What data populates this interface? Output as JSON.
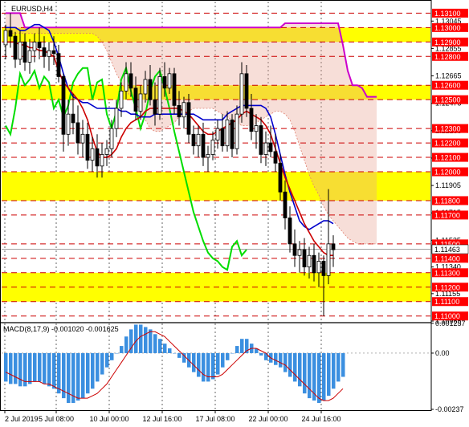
{
  "chart_data": {
    "type": "candlestick",
    "symbol": "EURUSD,H4",
    "indicator_label": "MACD(8,17,9) -0.001020 -0.001625",
    "price_axis": {
      "ylim": [
        1.10965,
        1.1318
      ],
      "ticks": [
        "1.13045",
        "1.12855",
        "1.12665",
        "1.12475",
        "1.12285",
        "1.12095",
        "1.11905",
        "1.11715",
        "1.11525",
        "1.11340",
        "1.11155",
        "1.10965"
      ]
    },
    "macd_axis": {
      "ylim": [
        -0.00237,
        0.00125
      ],
      "ticks": [
        "0.001257",
        "0.00",
        "-0.00237"
      ]
    },
    "x_ticks": [
      "2 Jul 2019",
      "5 Jul 08:00",
      "10 Jul 00:00",
      "12 Jul 16:00",
      "17 Jul 08:00",
      "22 Jul 00:00",
      "24 Jul 16:00"
    ],
    "levels": [
      {
        "label": "1.13100",
        "value": 1.131
      },
      {
        "label": "1.13000",
        "value": 1.13
      },
      {
        "label": "1.12900",
        "value": 1.129
      },
      {
        "label": "1.12800",
        "value": 1.128
      },
      {
        "label": "1.12600",
        "value": 1.126
      },
      {
        "label": "1.12500",
        "value": 1.125
      },
      {
        "label": "1.12300",
        "value": 1.123
      },
      {
        "label": "1.12200",
        "value": 1.122
      },
      {
        "label": "1.12100",
        "value": 1.121
      },
      {
        "label": "1.12000",
        "value": 1.12
      },
      {
        "label": "1.11800",
        "value": 1.118
      },
      {
        "label": "1.11700",
        "value": 1.117
      },
      {
        "label": "1.11500",
        "value": 1.115
      },
      {
        "label": "1.11400",
        "value": 1.114
      },
      {
        "label": "1.11300",
        "value": 1.113
      },
      {
        "label": "1.11200",
        "value": 1.112
      },
      {
        "label": "1.11100",
        "value": 1.111
      },
      {
        "label": "1.11000",
        "value": 1.11
      }
    ],
    "zones": [
      [
        1.129,
        1.13
      ],
      [
        1.125,
        1.126
      ],
      [
        1.118,
        1.12
      ],
      [
        1.111,
        1.113
      ]
    ],
    "current_price": "1.11463",
    "current_price_value": 1.11463,
    "colors": {
      "candle": "#000000",
      "level_line": "#cc0000",
      "zone": "#ffff00",
      "level_label_bg": "#ff0000",
      "kijun": "#cc0000",
      "tenkan": "#0000cc",
      "chikou": "#00dd00",
      "senkou_b": "#cc00cc",
      "senkou_a": "#e08070",
      "cloud": "#e8a090",
      "macd_histogram": "#3b8fe0",
      "macd_signal": "#cc0000",
      "grid": "#000000"
    },
    "candles_ohlc": [
      [
        1.1288,
        1.1302,
        1.1278,
        1.1298
      ],
      [
        1.1298,
        1.131,
        1.1286,
        1.1294
      ],
      [
        1.1294,
        1.1297,
        1.1272,
        1.1278
      ],
      [
        1.1278,
        1.1298,
        1.1274,
        1.129
      ],
      [
        1.129,
        1.1296,
        1.127,
        1.1276
      ],
      [
        1.1276,
        1.1292,
        1.1268,
        1.1284
      ],
      [
        1.1284,
        1.1296,
        1.1276,
        1.129
      ],
      [
        1.129,
        1.13,
        1.1278,
        1.1286
      ],
      [
        1.1286,
        1.1294,
        1.1272,
        1.128
      ],
      [
        1.128,
        1.129,
        1.127,
        1.1284
      ],
      [
        1.1284,
        1.1294,
        1.1274,
        1.1282
      ],
      [
        1.1282,
        1.1288,
        1.1262,
        1.1266
      ],
      [
        1.1266,
        1.1268,
        1.1214,
        1.1226
      ],
      [
        1.1226,
        1.125,
        1.1218,
        1.124
      ],
      [
        1.124,
        1.1254,
        1.1226,
        1.1234
      ],
      [
        1.1234,
        1.1246,
        1.1212,
        1.122
      ],
      [
        1.122,
        1.1236,
        1.121,
        1.1226
      ],
      [
        1.1226,
        1.1234,
        1.1202,
        1.1208
      ],
      [
        1.1208,
        1.1224,
        1.12,
        1.1216
      ],
      [
        1.1216,
        1.1226,
        1.1196,
        1.1204
      ],
      [
        1.1204,
        1.122,
        1.1196,
        1.1212
      ],
      [
        1.1212,
        1.1222,
        1.1204,
        1.1216
      ],
      [
        1.1216,
        1.1236,
        1.121,
        1.123
      ],
      [
        1.123,
        1.125,
        1.1224,
        1.1244
      ],
      [
        1.1244,
        1.1262,
        1.1238,
        1.1256
      ],
      [
        1.1256,
        1.1276,
        1.125,
        1.1268
      ],
      [
        1.1268,
        1.1276,
        1.1252,
        1.1258
      ],
      [
        1.1258,
        1.1266,
        1.1236,
        1.1242
      ],
      [
        1.1242,
        1.126,
        1.1236,
        1.1254
      ],
      [
        1.1254,
        1.127,
        1.1248,
        1.1264
      ],
      [
        1.1264,
        1.1274,
        1.1246,
        1.125
      ],
      [
        1.125,
        1.1262,
        1.1232,
        1.124
      ],
      [
        1.124,
        1.1272,
        1.1236,
        1.1266
      ],
      [
        1.1266,
        1.1276,
        1.1252,
        1.1258
      ],
      [
        1.1258,
        1.1272,
        1.1254,
        1.1268
      ],
      [
        1.1268,
        1.1272,
        1.124,
        1.1246
      ],
      [
        1.1246,
        1.1256,
        1.1232,
        1.1238
      ],
      [
        1.1238,
        1.1252,
        1.123,
        1.1248
      ],
      [
        1.1248,
        1.1254,
        1.122,
        1.1226
      ],
      [
        1.1226,
        1.1232,
        1.1212,
        1.1218
      ],
      [
        1.1218,
        1.1232,
        1.121,
        1.1226
      ],
      [
        1.1226,
        1.1234,
        1.1204,
        1.121
      ],
      [
        1.121,
        1.1218,
        1.12,
        1.1212
      ],
      [
        1.1212,
        1.1228,
        1.1208,
        1.1222
      ],
      [
        1.1222,
        1.1236,
        1.1216,
        1.123
      ],
      [
        1.123,
        1.124,
        1.1214,
        1.1218
      ],
      [
        1.1218,
        1.1242,
        1.1214,
        1.1236
      ],
      [
        1.1236,
        1.124,
        1.121,
        1.1216
      ],
      [
        1.1216,
        1.1246,
        1.1212,
        1.124
      ],
      [
        1.124,
        1.1276,
        1.1234,
        1.1268
      ],
      [
        1.1268,
        1.1274,
        1.1238,
        1.1244
      ],
      [
        1.1244,
        1.1254,
        1.1222,
        1.1228
      ],
      [
        1.1228,
        1.124,
        1.1216,
        1.1232
      ],
      [
        1.1232,
        1.1238,
        1.1206,
        1.1212
      ],
      [
        1.1212,
        1.1228,
        1.1204,
        1.122
      ],
      [
        1.122,
        1.1232,
        1.121,
        1.1214
      ],
      [
        1.1214,
        1.1226,
        1.12,
        1.1206
      ],
      [
        1.1206,
        1.1212,
        1.118,
        1.1186
      ],
      [
        1.1186,
        1.1194,
        1.116,
        1.1168
      ],
      [
        1.1168,
        1.1176,
        1.1144,
        1.115
      ],
      [
        1.115,
        1.116,
        1.1134,
        1.1142
      ],
      [
        1.1142,
        1.1152,
        1.113,
        1.1146
      ],
      [
        1.1146,
        1.1154,
        1.1128,
        1.1134
      ],
      [
        1.1134,
        1.1148,
        1.1126,
        1.1142
      ],
      [
        1.1142,
        1.115,
        1.1124,
        1.113
      ],
      [
        1.113,
        1.1144,
        1.112,
        1.1138
      ],
      [
        1.1138,
        1.1142,
        1.11,
        1.1128
      ],
      [
        1.1128,
        1.1188,
        1.1122,
        1.115
      ],
      [
        1.115,
        1.1156,
        1.1134,
        1.1146
      ]
    ],
    "kijun_sen": [
      1.129,
      1.129,
      1.129,
      1.1288,
      1.1288,
      1.1286,
      1.1286,
      1.1284,
      1.1284,
      1.1282,
      1.128,
      1.127,
      1.1262,
      1.1258,
      1.1254,
      1.125,
      1.1244,
      1.1236,
      1.1224,
      1.1214,
      1.121,
      1.121,
      1.1212,
      1.1216,
      1.1224,
      1.123,
      1.1234,
      1.1236,
      1.1238,
      1.1242,
      1.1244,
      1.1244,
      1.1244,
      1.1244,
      1.1244,
      1.1244,
      1.1244,
      1.1242,
      1.124,
      1.1236,
      1.1232,
      1.1228,
      1.1226,
      1.1226,
      1.1228,
      1.123,
      1.1232,
      1.1234,
      1.1236,
      1.124,
      1.1242,
      1.124,
      1.1238,
      1.1236,
      1.1232,
      1.1226,
      1.1216,
      1.1206,
      1.1196,
      1.1188,
      1.118,
      1.1172,
      1.1164,
      1.1158,
      1.1152,
      1.1148,
      1.1144,
      1.1142,
      1.1142
    ],
    "tenkan_sen": [
      1.13,
      1.13,
      1.13,
      1.1298,
      1.1298,
      1.13,
      1.1302,
      1.1302,
      1.13,
      1.1298,
      1.129,
      1.128,
      1.1268,
      1.1258,
      1.1252,
      1.125,
      1.1248,
      1.1248,
      1.1246,
      1.1244,
      1.1244,
      1.1244,
      1.1244,
      1.1244,
      1.1242,
      1.1242,
      1.124,
      1.124,
      1.1238,
      1.1238,
      1.1238,
      1.124,
      1.124,
      1.124,
      1.124,
      1.124,
      1.124,
      1.124,
      1.124,
      1.124,
      1.1238,
      1.1236,
      1.1236,
      1.1236,
      1.1236,
      1.1236,
      1.124,
      1.1242,
      1.1244,
      1.1246,
      1.1246,
      1.1246,
      1.1246,
      1.1246,
      1.1244,
      1.1238,
      1.1226,
      1.1212,
      1.1198,
      1.1186,
      1.1176,
      1.1166,
      1.1162,
      1.116,
      1.1162,
      1.1164,
      1.1166,
      1.1166,
      1.1164
    ],
    "chikou_span": [
      1.1232,
      1.1226,
      1.1244,
      1.1268,
      1.126,
      1.1264,
      1.127,
      1.1258,
      1.1266,
      1.1262,
      1.1244,
      1.125,
      1.1238,
      1.1246,
      1.1262,
      1.1268,
      1.1272,
      1.1272,
      1.125,
      1.1262,
      1.1264,
      1.124,
      1.123,
      1.1242,
      1.1264,
      1.1272,
      1.1256,
      1.1244,
      1.123,
      1.124,
      1.1256,
      1.1266,
      1.127,
      1.1258,
      1.1244,
      1.1228,
      1.1214,
      1.12,
      1.1186,
      1.1172,
      1.1162,
      1.1152,
      1.1144,
      1.114,
      1.1138,
      1.1134,
      1.1132,
      1.1148,
      1.1152,
      1.1142,
      1.1146
    ],
    "senkou_a": [
      1.1296,
      1.1296,
      1.1296,
      1.1296,
      1.1296,
      1.1296,
      1.1296,
      1.1296,
      1.1296,
      1.1296,
      1.1296,
      1.1296,
      1.1296,
      1.1296,
      1.1296,
      1.1296,
      1.1296,
      1.1296,
      1.1296,
      1.1294,
      1.129,
      1.1284,
      1.1276,
      1.1268,
      1.1262,
      1.1256,
      1.1252,
      1.1248,
      1.1242,
      1.1236,
      1.123,
      1.1228,
      1.1228,
      1.123,
      1.1232,
      1.1234,
      1.1238,
      1.124,
      1.1242,
      1.1244,
      1.1244,
      1.1244,
      1.1244,
      1.1244,
      1.1242,
      1.124,
      1.1238,
      1.1236,
      1.1234,
      1.1232,
      1.1232,
      1.1232,
      1.1234,
      1.1236,
      1.1238,
      1.124,
      1.1242,
      1.1242,
      1.124,
      1.1236,
      1.1228,
      1.1218,
      1.1208,
      1.1198,
      1.119,
      1.1184,
      1.1176,
      1.117,
      1.1166,
      1.1162,
      1.1158,
      1.1154,
      1.1152,
      1.115,
      1.115,
      1.115,
      1.115,
      1.115
    ],
    "senkou_b": [
      1.131,
      1.131,
      1.131,
      1.131,
      1.13,
      1.13,
      1.13,
      1.13,
      1.13,
      1.13,
      1.13,
      1.13,
      1.13,
      1.13,
      1.13,
      1.13,
      1.13,
      1.13,
      1.13,
      1.13,
      1.13,
      1.13,
      1.13,
      1.13,
      1.13,
      1.13,
      1.13,
      1.13,
      1.13,
      1.13,
      1.13,
      1.13,
      1.13,
      1.13,
      1.13,
      1.13,
      1.13,
      1.13,
      1.13,
      1.13,
      1.13,
      1.13,
      1.13,
      1.13,
      1.13,
      1.13,
      1.13,
      1.13,
      1.13,
      1.13,
      1.13,
      1.13,
      1.13,
      1.13,
      1.13,
      1.13,
      1.13,
      1.13,
      1.1303,
      1.1303,
      1.1303,
      1.1303,
      1.1303,
      1.1303,
      1.1303,
      1.1303,
      1.1303,
      1.1303,
      1.1303,
      1.1303,
      1.1288,
      1.127,
      1.126,
      1.126,
      1.1258,
      1.1252,
      1.1252,
      1.1252
    ],
    "macd_histogram": [
      -0.0012,
      -0.0013,
      -0.0013,
      -0.0014,
      -0.0014,
      -0.0013,
      -0.0012,
      -0.0012,
      -0.0013,
      -0.0014,
      -0.0015,
      -0.0017,
      -0.0019,
      -0.0021,
      -0.0021,
      -0.002,
      -0.0019,
      -0.0017,
      -0.0015,
      -0.0012,
      -0.0009,
      -0.0006,
      -0.0003,
      0.0,
      0.0003,
      0.0007,
      0.001,
      0.0012,
      0.0012,
      0.0011,
      0.001,
      0.0008,
      0.0006,
      0.0004,
      0.0002,
      0.0,
      -0.0002,
      -0.0004,
      -0.0006,
      -0.0008,
      -0.001,
      -0.0012,
      -0.0012,
      -0.0011,
      -0.0009,
      -0.0006,
      -0.0003,
      0.0,
      0.0003,
      0.0006,
      0.0006,
      0.0004,
      0.0002,
      -0.0001,
      -0.0003,
      -0.0004,
      -0.0005,
      -0.0006,
      -0.0008,
      -0.001,
      -0.0012,
      -0.0014,
      -0.0017,
      -0.0019,
      -0.002,
      -0.0021,
      -0.002,
      -0.0018,
      -0.0015,
      -0.0012,
      -0.001
    ],
    "macd_signal": [
      -0.0008,
      -0.0009,
      -0.001,
      -0.0011,
      -0.0012,
      -0.0012,
      -0.0012,
      -0.0012,
      -0.0013,
      -0.0013,
      -0.0014,
      -0.0015,
      -0.0016,
      -0.0017,
      -0.0018,
      -0.0019,
      -0.0019,
      -0.0019,
      -0.0018,
      -0.0017,
      -0.0015,
      -0.0013,
      -0.001,
      -0.0007,
      -0.0004,
      -0.0001,
      0.0002,
      0.0005,
      0.0007,
      0.0008,
      0.0009,
      0.0009,
      0.0008,
      0.0007,
      0.0005,
      0.0003,
      0.0001,
      -0.0001,
      -0.0003,
      -0.0005,
      -0.0007,
      -0.0009,
      -0.001,
      -0.001,
      -0.001,
      -0.0009,
      -0.0007,
      -0.0005,
      -0.0003,
      -0.0001,
      0.0001,
      0.0002,
      0.0002,
      0.0001,
      0.0,
      -0.0002,
      -0.0003,
      -0.0004,
      -0.0005,
      -0.0007,
      -0.0009,
      -0.0011,
      -0.0013,
      -0.0015,
      -0.0017,
      -0.0019,
      -0.002,
      -0.002,
      -0.0019,
      -0.0017,
      -0.0015
    ]
  }
}
